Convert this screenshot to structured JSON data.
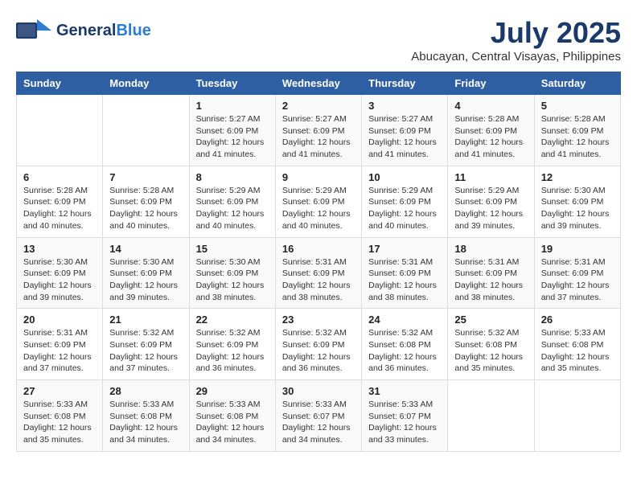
{
  "header": {
    "logo_general": "General",
    "logo_blue": "Blue",
    "title": "July 2025",
    "subtitle": "Abucayan, Central Visayas, Philippines"
  },
  "days_of_week": [
    "Sunday",
    "Monday",
    "Tuesday",
    "Wednesday",
    "Thursday",
    "Friday",
    "Saturday"
  ],
  "weeks": [
    [
      {
        "day": "",
        "content": ""
      },
      {
        "day": "",
        "content": ""
      },
      {
        "day": "1",
        "content": "Sunrise: 5:27 AM\nSunset: 6:09 PM\nDaylight: 12 hours and 41 minutes."
      },
      {
        "day": "2",
        "content": "Sunrise: 5:27 AM\nSunset: 6:09 PM\nDaylight: 12 hours and 41 minutes."
      },
      {
        "day": "3",
        "content": "Sunrise: 5:27 AM\nSunset: 6:09 PM\nDaylight: 12 hours and 41 minutes."
      },
      {
        "day": "4",
        "content": "Sunrise: 5:28 AM\nSunset: 6:09 PM\nDaylight: 12 hours and 41 minutes."
      },
      {
        "day": "5",
        "content": "Sunrise: 5:28 AM\nSunset: 6:09 PM\nDaylight: 12 hours and 41 minutes."
      }
    ],
    [
      {
        "day": "6",
        "content": "Sunrise: 5:28 AM\nSunset: 6:09 PM\nDaylight: 12 hours and 40 minutes."
      },
      {
        "day": "7",
        "content": "Sunrise: 5:28 AM\nSunset: 6:09 PM\nDaylight: 12 hours and 40 minutes."
      },
      {
        "day": "8",
        "content": "Sunrise: 5:29 AM\nSunset: 6:09 PM\nDaylight: 12 hours and 40 minutes."
      },
      {
        "day": "9",
        "content": "Sunrise: 5:29 AM\nSunset: 6:09 PM\nDaylight: 12 hours and 40 minutes."
      },
      {
        "day": "10",
        "content": "Sunrise: 5:29 AM\nSunset: 6:09 PM\nDaylight: 12 hours and 40 minutes."
      },
      {
        "day": "11",
        "content": "Sunrise: 5:29 AM\nSunset: 6:09 PM\nDaylight: 12 hours and 39 minutes."
      },
      {
        "day": "12",
        "content": "Sunrise: 5:30 AM\nSunset: 6:09 PM\nDaylight: 12 hours and 39 minutes."
      }
    ],
    [
      {
        "day": "13",
        "content": "Sunrise: 5:30 AM\nSunset: 6:09 PM\nDaylight: 12 hours and 39 minutes."
      },
      {
        "day": "14",
        "content": "Sunrise: 5:30 AM\nSunset: 6:09 PM\nDaylight: 12 hours and 39 minutes."
      },
      {
        "day": "15",
        "content": "Sunrise: 5:30 AM\nSunset: 6:09 PM\nDaylight: 12 hours and 38 minutes."
      },
      {
        "day": "16",
        "content": "Sunrise: 5:31 AM\nSunset: 6:09 PM\nDaylight: 12 hours and 38 minutes."
      },
      {
        "day": "17",
        "content": "Sunrise: 5:31 AM\nSunset: 6:09 PM\nDaylight: 12 hours and 38 minutes."
      },
      {
        "day": "18",
        "content": "Sunrise: 5:31 AM\nSunset: 6:09 PM\nDaylight: 12 hours and 38 minutes."
      },
      {
        "day": "19",
        "content": "Sunrise: 5:31 AM\nSunset: 6:09 PM\nDaylight: 12 hours and 37 minutes."
      }
    ],
    [
      {
        "day": "20",
        "content": "Sunrise: 5:31 AM\nSunset: 6:09 PM\nDaylight: 12 hours and 37 minutes."
      },
      {
        "day": "21",
        "content": "Sunrise: 5:32 AM\nSunset: 6:09 PM\nDaylight: 12 hours and 37 minutes."
      },
      {
        "day": "22",
        "content": "Sunrise: 5:32 AM\nSunset: 6:09 PM\nDaylight: 12 hours and 36 minutes."
      },
      {
        "day": "23",
        "content": "Sunrise: 5:32 AM\nSunset: 6:09 PM\nDaylight: 12 hours and 36 minutes."
      },
      {
        "day": "24",
        "content": "Sunrise: 5:32 AM\nSunset: 6:08 PM\nDaylight: 12 hours and 36 minutes."
      },
      {
        "day": "25",
        "content": "Sunrise: 5:32 AM\nSunset: 6:08 PM\nDaylight: 12 hours and 35 minutes."
      },
      {
        "day": "26",
        "content": "Sunrise: 5:33 AM\nSunset: 6:08 PM\nDaylight: 12 hours and 35 minutes."
      }
    ],
    [
      {
        "day": "27",
        "content": "Sunrise: 5:33 AM\nSunset: 6:08 PM\nDaylight: 12 hours and 35 minutes."
      },
      {
        "day": "28",
        "content": "Sunrise: 5:33 AM\nSunset: 6:08 PM\nDaylight: 12 hours and 34 minutes."
      },
      {
        "day": "29",
        "content": "Sunrise: 5:33 AM\nSunset: 6:08 PM\nDaylight: 12 hours and 34 minutes."
      },
      {
        "day": "30",
        "content": "Sunrise: 5:33 AM\nSunset: 6:07 PM\nDaylight: 12 hours and 34 minutes."
      },
      {
        "day": "31",
        "content": "Sunrise: 5:33 AM\nSunset: 6:07 PM\nDaylight: 12 hours and 33 minutes."
      },
      {
        "day": "",
        "content": ""
      },
      {
        "day": "",
        "content": ""
      }
    ]
  ]
}
